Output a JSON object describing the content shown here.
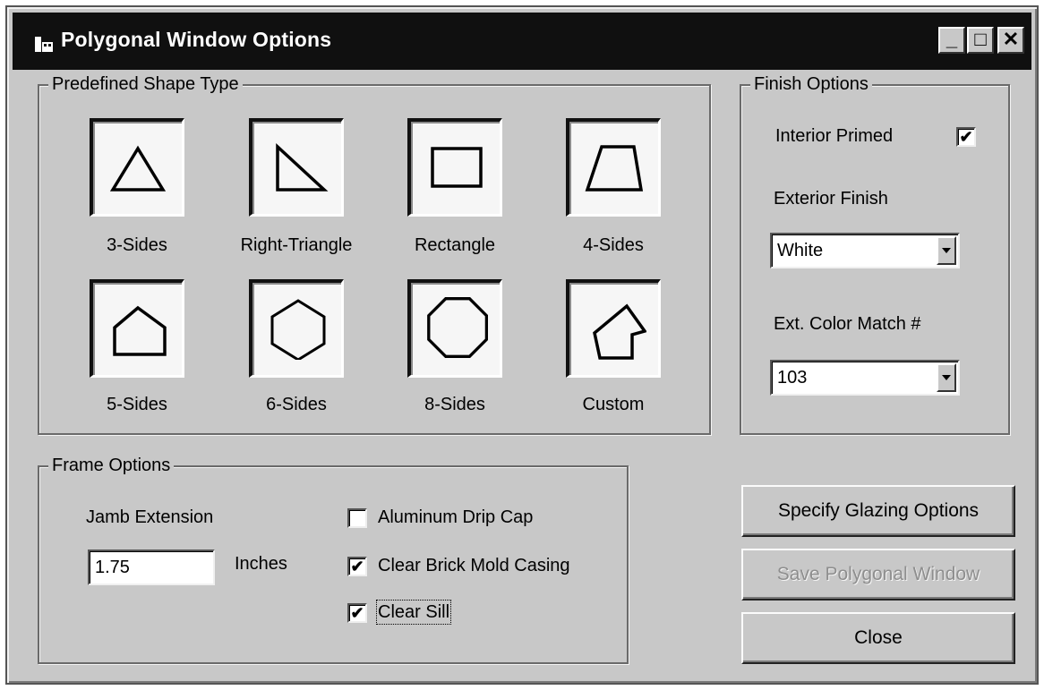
{
  "window": {
    "title": "Polygonal Window Options",
    "caption_buttons": {
      "minimize": "_",
      "maximize": "□",
      "close": "✕"
    }
  },
  "shape_group": {
    "label": "Predefined Shape Type",
    "shapes": [
      {
        "label": "3-Sides",
        "icon": "triangle-icon"
      },
      {
        "label": "Right-Triangle",
        "icon": "right-triangle-icon"
      },
      {
        "label": "Rectangle",
        "icon": "rectangle-icon"
      },
      {
        "label": "4-Sides",
        "icon": "trapezoid-icon"
      },
      {
        "label": "5-Sides",
        "icon": "pentagon-icon"
      },
      {
        "label": "6-Sides",
        "icon": "hexagon-icon"
      },
      {
        "label": "8-Sides",
        "icon": "octagon-icon"
      },
      {
        "label": "Custom",
        "icon": "custom-polygon-icon"
      }
    ]
  },
  "finish_group": {
    "label": "Finish Options",
    "interior_primed_label": "Interior Primed",
    "interior_primed_checked": true,
    "exterior_finish_label": "Exterior Finish",
    "exterior_finish_value": "White",
    "color_match_label": "Ext. Color Match #",
    "color_match_value": "103"
  },
  "frame_group": {
    "label": "Frame Options",
    "jamb_extension_label": "Jamb Extension",
    "jamb_extension_value": "1.75",
    "inches_label": "Inches",
    "aluminum_drip_cap_label": "Aluminum Drip Cap",
    "aluminum_drip_cap_checked": false,
    "brick_mold_label": "Clear Brick Mold Casing",
    "brick_mold_checked": true,
    "clear_sill_label": "Clear Sill",
    "clear_sill_checked": true
  },
  "buttons": {
    "glazing": "Specify Glazing Options",
    "save": "Save Polygonal Window",
    "save_enabled": false,
    "close": "Close"
  },
  "check_mark": "✔"
}
